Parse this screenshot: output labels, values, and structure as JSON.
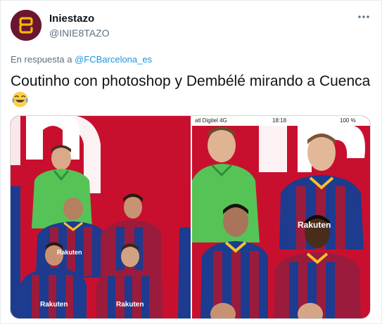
{
  "tweet": {
    "author_name": "Iniestazo",
    "author_handle": "@INIE8TAZO",
    "reply_prefix": "En respuesta a",
    "reply_to": "@FCBarcelona_es",
    "text": "Coutinho con photoshop y Dembélé mirando a Cuenca",
    "emoji": "crying-laughing-emoji"
  },
  "media": {
    "right_status_bar": {
      "carrier": "atl Digitel 4G",
      "time": "18:18",
      "battery": "100 %"
    },
    "sponsor": "Rakuten",
    "brand_colors": {
      "red": "#c8102e",
      "blue": "#1d3b8f",
      "garnet": "#9b1b3d",
      "gold": "#f2c230",
      "keeper_green": "#56c357"
    }
  }
}
